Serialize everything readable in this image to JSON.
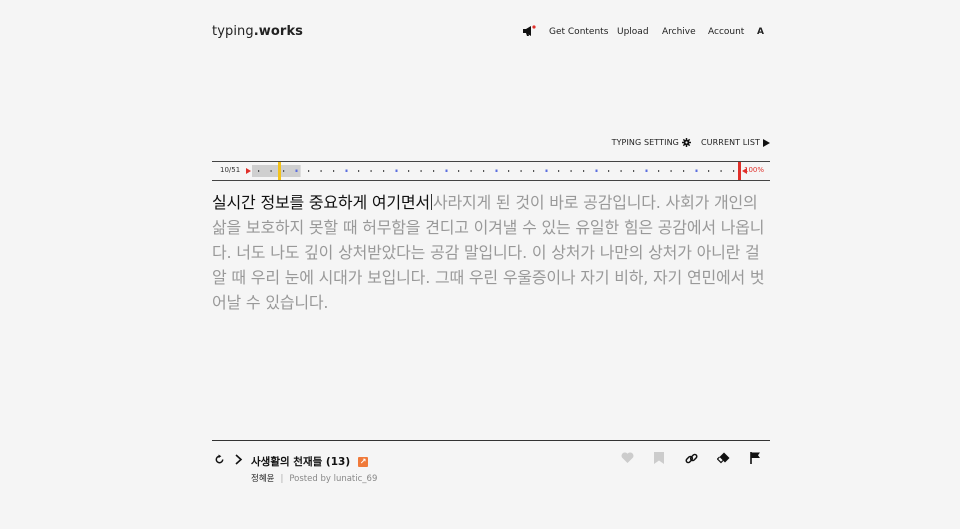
{
  "header": {
    "logo_prefix": "typing",
    "logo_suffix": ".works",
    "nav": [
      {
        "name": "nav-get-contents",
        "label": "Get Contents"
      },
      {
        "name": "nav-upload",
        "label": "Upload"
      },
      {
        "name": "nav-archive",
        "label": "Archive"
      },
      {
        "name": "nav-account",
        "label": "Account"
      },
      {
        "name": "nav-language",
        "label": "A"
      }
    ]
  },
  "settings": {
    "typing_setting": "TYPING SETTING",
    "current_list": "CURRENT LIST"
  },
  "progress": {
    "count": "10/51",
    "percent": "100%",
    "current_fraction": 0.125
  },
  "text": {
    "typed": "실시간 정보를 중요하게 여기면서",
    "remaining": "사라지게 된 것이 바로 공감입니다. 사회가 개인의 삶을 보호하지 못할 때 허무함을 견디고 이겨낼 수 있는 유일한 힘은 공감에서 나옵니다. 너도 나도 깊이 상처받았다는 공감 말입니다. 이 상처가 나만의 상처가 아니란 걸 알 때 우리 눈에 시대가 보입니다. 그때 우린 우울증이나 자기 비하, 자기 연민에서 벗어날 수 있습니다."
  },
  "footer": {
    "title": "사생활의 천재들 (13)",
    "author": "정혜윤",
    "posted_by": "Posted by lunatic_69"
  },
  "colors": {
    "accent_red": "#e0302a",
    "marker_yellow": "#f2c21b",
    "dot_blue": "#5b6ee0",
    "external_orange": "#f07a3a"
  }
}
